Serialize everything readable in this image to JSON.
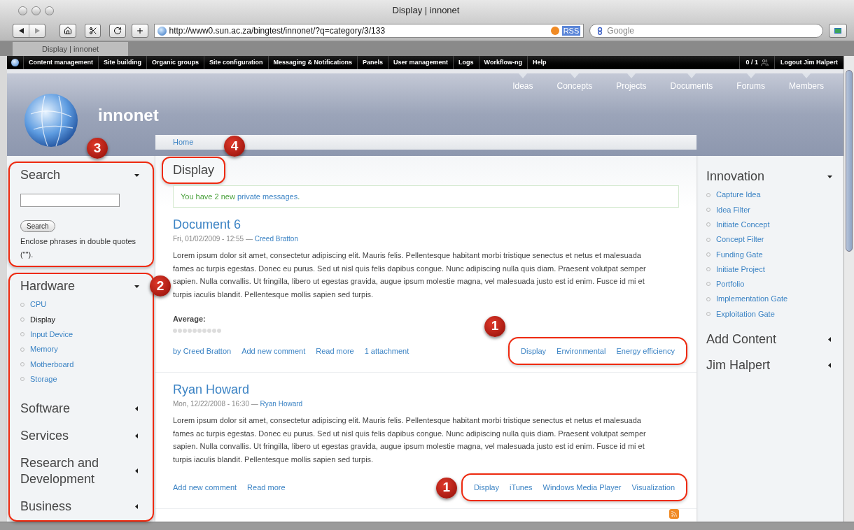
{
  "browser": {
    "title": "Display | innonet",
    "url": "http://www0.sun.ac.za/bingtest/innonet/?q=category/3/133",
    "feed_badge": "RSS",
    "search_placeholder": "Google",
    "tabs": [
      {
        "label": "Display | innonet",
        "selected": true
      }
    ]
  },
  "admin_menu": {
    "items": [
      "Content management",
      "Site building",
      "Organic groups",
      "Site configuration",
      "Messaging & Notifications",
      "Panels",
      "User management",
      "Logs",
      "Workflow-ng",
      "Help"
    ],
    "user_count": "0 / 1",
    "logout": "Logout Jim Halpert"
  },
  "site": {
    "name": "innonet",
    "nav": [
      "Ideas",
      "Concepts",
      "Projects",
      "Documents",
      "Forums",
      "Members"
    ]
  },
  "breadcrumb": [
    "Home"
  ],
  "page_title": {
    "text": "Display",
    "callout": "4"
  },
  "message": {
    "text": "You have 2 new ",
    "link": "private messages",
    "end": "."
  },
  "posts": [
    {
      "title": "Document 6",
      "date": "Fri, 01/02/2009 - 12:55 — ",
      "author": "Creed Bratton",
      "body": "Lorem ipsum dolor sit amet, consectetur adipiscing elit. Mauris felis. Pellentesque habitant morbi tristique senectus et netus et malesuada fames ac turpis egestas. Donec eu purus. Sed ut nisl quis felis dapibus congue. Nunc adipiscing nulla quis diam. Praesent volutpat semper sapien. Nulla convallis. Ut fringilla, libero ut egestas gravida, augue ipsum molestie magna, vel malesuada justo est id enim. Fusce id mi et turpis iaculis blandit. Pellentesque mollis sapien sed turpis.",
      "rating": {
        "label": "Average:",
        "stars": 0
      },
      "links": [
        "by Creed Bratton",
        "Add new comment",
        "Read more",
        "1 attachment"
      ],
      "terms": [
        "Display",
        "Environmental",
        "Energy efficiency"
      ],
      "callout": "1"
    },
    {
      "title": "Ryan Howard",
      "date": "Mon, 12/22/2008 - 16:30 — ",
      "author": "Ryan Howard",
      "body": "Lorem ipsum dolor sit amet, consectetur adipiscing elit. Mauris felis. Pellentesque habitant morbi tristique senectus et netus et malesuada fames ac turpis egestas. Donec eu purus. Sed ut nisl quis felis dapibus congue. Nunc adipiscing nulla quis diam. Praesent volutpat semper sapien. Nulla convallis. Ut fringilla, libero ut egestas gravida, augue ipsum molestie magna, vel malesuada justo est id enim. Fusce id mi et turpis iaculis blandit. Pellentesque mollis sapien sed turpis.",
      "links": [
        "Add new comment",
        "Read more"
      ],
      "terms": [
        "Display",
        "iTunes",
        "Windows Media Player",
        "Visualization"
      ],
      "callout": "1"
    }
  ],
  "left_blocks": [
    {
      "kind": "search",
      "title": "Search",
      "expanded": true,
      "callout": "3",
      "button": "Search",
      "help": "Enclose phrases in double quotes (\"\")."
    },
    {
      "kind": "menu",
      "title": "Hardware",
      "expanded": true,
      "callout": "2",
      "items": [
        {
          "label": "CPU",
          "selected": false
        },
        {
          "label": "Display",
          "selected": true
        },
        {
          "label": "Input Device",
          "selected": false
        },
        {
          "label": "Memory",
          "selected": false
        },
        {
          "label": "Motherboard",
          "selected": false
        },
        {
          "label": "Storage",
          "selected": false
        }
      ]
    },
    {
      "title": "Software",
      "expanded": false
    },
    {
      "title": "Services",
      "expanded": false
    },
    {
      "title": "Research and Development",
      "expanded": false
    },
    {
      "title": "Business",
      "expanded": false
    }
  ],
  "right_blocks": [
    {
      "kind": "menu",
      "title": "Innovation",
      "expanded": true,
      "items": [
        {
          "label": "Capture Idea",
          "selected": false
        },
        {
          "label": "Idea Filter",
          "selected": false
        },
        {
          "label": "Initiate Concept",
          "selected": false
        },
        {
          "label": "Concept Filter",
          "selected": false
        },
        {
          "label": "Funding Gate",
          "selected": false
        },
        {
          "label": "Initiate Project",
          "selected": false
        },
        {
          "label": "Portfolio",
          "selected": false
        },
        {
          "label": "Implementation Gate",
          "selected": false
        },
        {
          "label": "Exploitation Gate",
          "selected": false
        }
      ]
    },
    {
      "title": "Add Content",
      "expanded": false
    },
    {
      "title": "Jim Halpert",
      "expanded": false
    }
  ]
}
